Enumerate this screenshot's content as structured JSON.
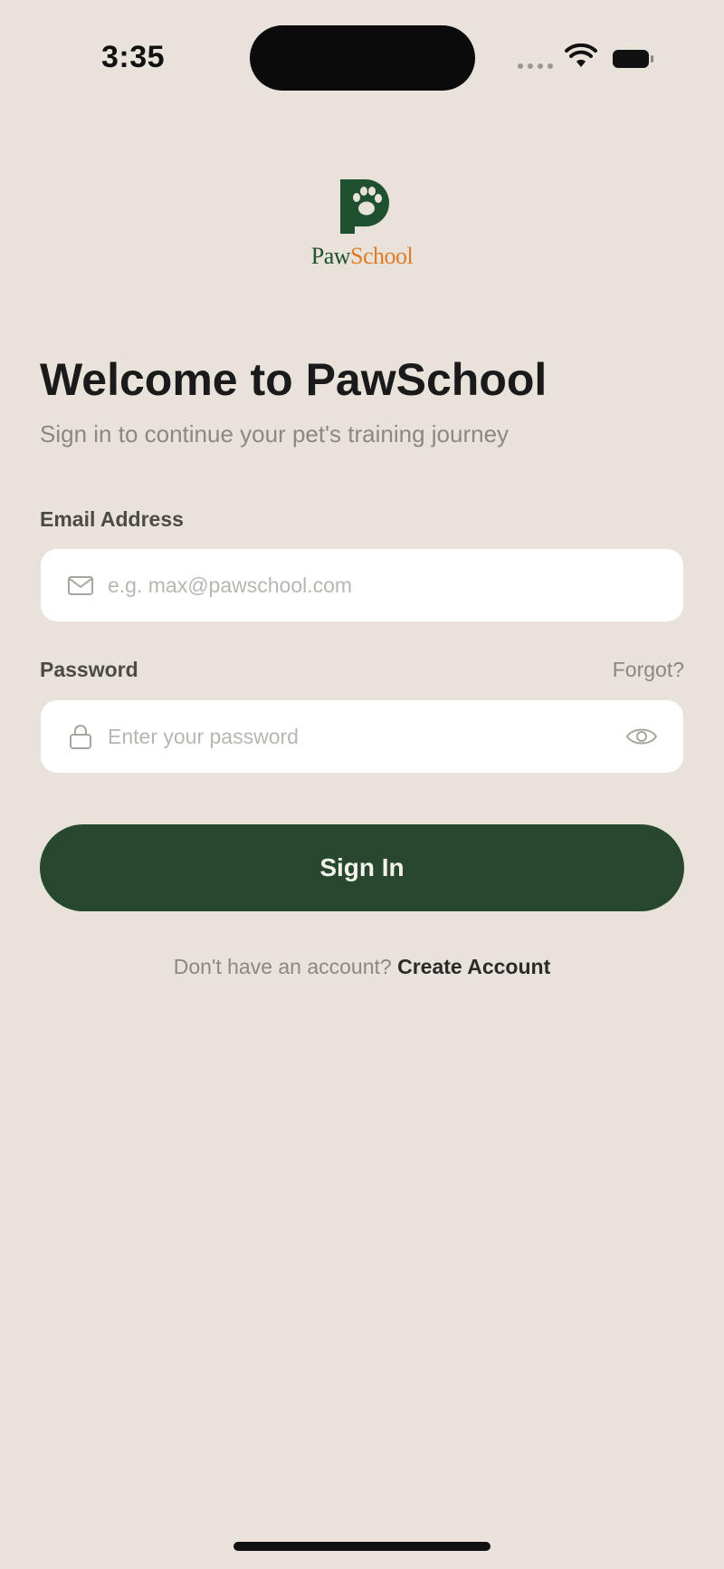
{
  "status_bar": {
    "time": "3:35"
  },
  "brand": {
    "logo_part1": "Paw",
    "logo_part2": "School",
    "primary_color": "#27482F",
    "accent_color": "#e07a28"
  },
  "welcome": {
    "title": "Welcome to PawSchool",
    "subtitle": "Sign in to continue your pet's training journey"
  },
  "form": {
    "email": {
      "label": "Email Address",
      "placeholder": "e.g. max@pawschool.com",
      "value": "",
      "icon": "mail-icon"
    },
    "password": {
      "label": "Password",
      "placeholder": "Enter your password",
      "value": "",
      "icon": "lock-icon",
      "toggle_icon": "eye-icon"
    },
    "forgot_label": "Forgot?",
    "submit_label": "Sign In"
  },
  "footer": {
    "prompt": "Don't have an account?",
    "link_label": "Create Account"
  }
}
